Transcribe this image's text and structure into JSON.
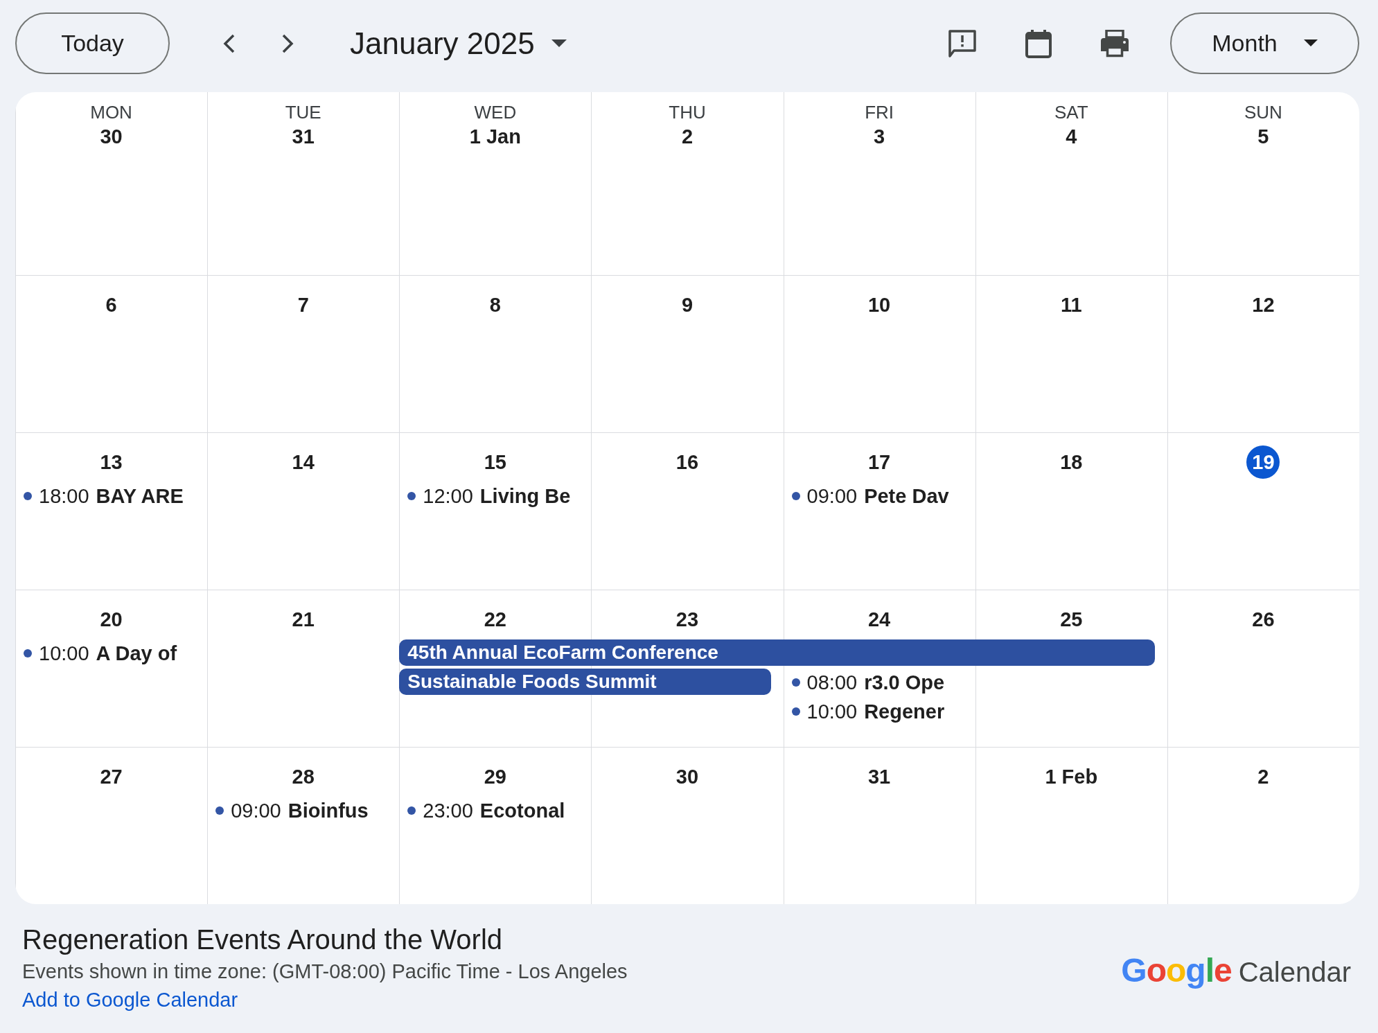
{
  "toolbar": {
    "today_button": "Today",
    "title": "January 2025",
    "view_button": "Month"
  },
  "weekdays": [
    "MON",
    "TUE",
    "WED",
    "THU",
    "FRI",
    "SAT",
    "SUN"
  ],
  "weeks": [
    {
      "days": [
        {
          "label": "30",
          "today": false
        },
        {
          "label": "31",
          "today": false
        },
        {
          "label": "1 Jan",
          "today": false
        },
        {
          "label": "2",
          "today": false
        },
        {
          "label": "3",
          "today": false
        },
        {
          "label": "4",
          "today": false
        },
        {
          "label": "5",
          "today": false
        }
      ]
    },
    {
      "days": [
        {
          "label": "6",
          "today": false
        },
        {
          "label": "7",
          "today": false
        },
        {
          "label": "8",
          "today": false
        },
        {
          "label": "9",
          "today": false
        },
        {
          "label": "10",
          "today": false
        },
        {
          "label": "11",
          "today": false
        },
        {
          "label": "12",
          "today": false
        }
      ]
    },
    {
      "days": [
        {
          "label": "13",
          "today": false,
          "events": [
            {
              "kind": "timed",
              "time": "18:00",
              "title": "BAY ARE"
            }
          ]
        },
        {
          "label": "14",
          "today": false
        },
        {
          "label": "15",
          "today": false,
          "events": [
            {
              "kind": "timed",
              "time": "12:00",
              "title": "Living Be"
            }
          ]
        },
        {
          "label": "16",
          "today": false
        },
        {
          "label": "17",
          "today": false,
          "events": [
            {
              "kind": "timed",
              "time": "09:00",
              "title": "Pete Dav"
            }
          ]
        },
        {
          "label": "18",
          "today": false
        },
        {
          "label": "19",
          "today": true
        }
      ]
    },
    {
      "days": [
        {
          "label": "20",
          "today": false,
          "events": [
            {
              "kind": "timed",
              "time": "10:00",
              "title": "A Day of"
            }
          ]
        },
        {
          "label": "21",
          "today": false
        },
        {
          "label": "22",
          "today": false,
          "events": [
            {
              "kind": "bar",
              "title": "45th Annual EcoFarm Conference"
            },
            {
              "kind": "bar",
              "title": "Sustainable Foods Summit"
            }
          ]
        },
        {
          "label": "23",
          "today": false,
          "events": [
            {
              "kind": "continued"
            },
            {
              "kind": "continued"
            }
          ]
        },
        {
          "label": "24",
          "today": false,
          "events": [
            {
              "kind": "continued"
            },
            {
              "kind": "timed",
              "time": "08:00",
              "title": "r3.0 Ope"
            },
            {
              "kind": "timed",
              "time": "10:00",
              "title": "Regener"
            }
          ]
        },
        {
          "label": "25",
          "today": false,
          "events": [
            {
              "kind": "continued"
            }
          ]
        },
        {
          "label": "26",
          "today": false
        }
      ]
    },
    {
      "days": [
        {
          "label": "27",
          "today": false
        },
        {
          "label": "28",
          "today": false,
          "events": [
            {
              "kind": "timed",
              "time": "09:00",
              "title": "Bioinfus"
            }
          ]
        },
        {
          "label": "29",
          "today": false,
          "events": [
            {
              "kind": "timed",
              "time": "23:00",
              "title": "Ecotonal"
            }
          ]
        },
        {
          "label": "30",
          "today": false
        },
        {
          "label": "31",
          "today": false
        },
        {
          "label": "1 Feb",
          "today": false
        },
        {
          "label": "2",
          "today": false
        }
      ]
    }
  ],
  "footer": {
    "title": "Regeneration Events Around the World",
    "timezone": "Events shown in time zone: (GMT-08:00) Pacific Time - Los Angeles",
    "link": "Add to Google Calendar",
    "brand": "Google",
    "product": "Calendar"
  }
}
